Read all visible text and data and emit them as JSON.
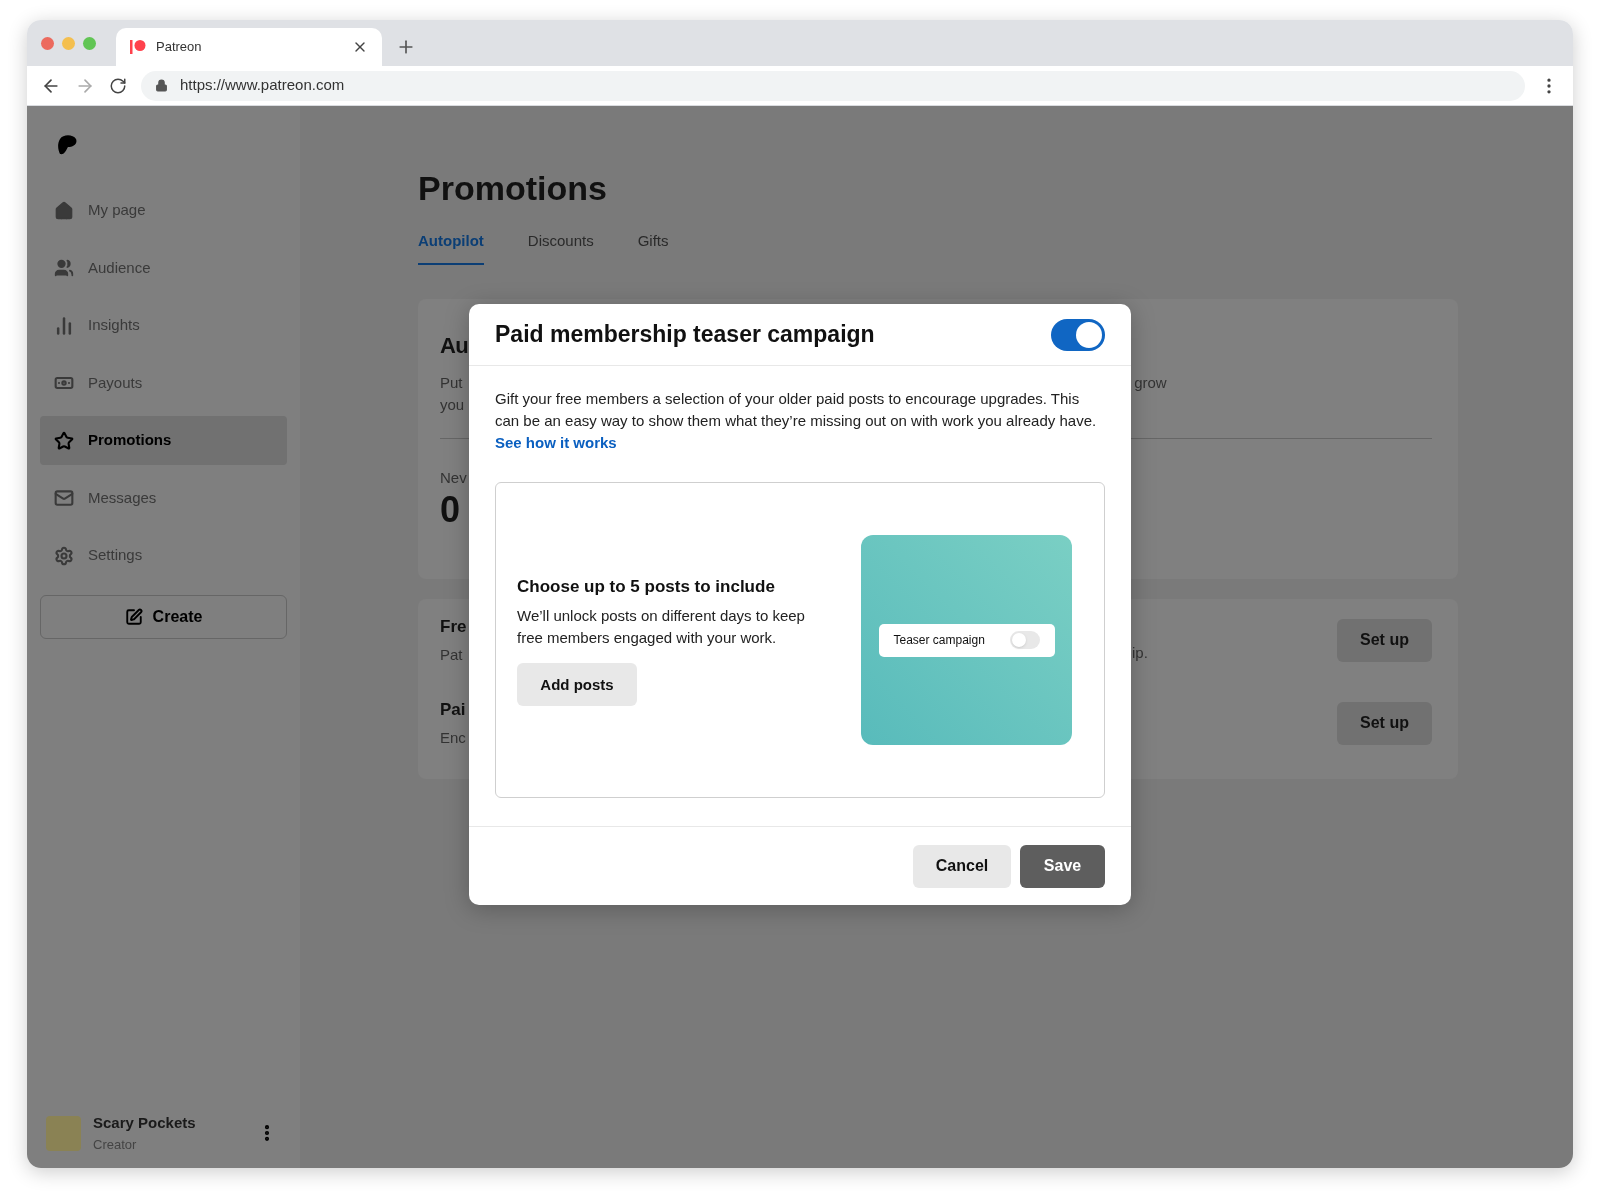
{
  "browser": {
    "tab_title": "Patreon",
    "url": "https://www.patreon.com"
  },
  "sidebar": {
    "items": [
      {
        "label": "My page",
        "selected": false
      },
      {
        "label": "Audience",
        "selected": false
      },
      {
        "label": "Insights",
        "selected": false
      },
      {
        "label": "Payouts",
        "selected": false
      },
      {
        "label": "Promotions",
        "selected": true
      },
      {
        "label": "Messages",
        "selected": false
      },
      {
        "label": "Settings",
        "selected": false
      }
    ],
    "create_button": "Create",
    "user": {
      "name": "Scary Pockets",
      "role": "Creator"
    }
  },
  "page": {
    "title": "Promotions",
    "tabs": [
      {
        "label": "Autopilot",
        "selected": true
      },
      {
        "label": "Discounts",
        "selected": false
      },
      {
        "label": "Gifts",
        "selected": false
      }
    ],
    "summary_card": {
      "heading": "Au",
      "text_lines": [
        "Put",
        "you"
      ],
      "text_right": "grow",
      "stat_label": "Nev",
      "stat_value": "0"
    },
    "rows": [
      {
        "title": "Fre",
        "text": "Pat",
        "text_right": "ip.",
        "button": "Set up"
      },
      {
        "title": "Pai",
        "text": "Enc",
        "button": "Set up"
      }
    ]
  },
  "modal": {
    "title": "Paid membership teaser campaign",
    "on": true,
    "description": "Gift your free members a selection of your older paid posts to encourage upgrades. This can be an easy way to show them what they’re missing out on with work you already have.",
    "link": "See how it works",
    "panel": {
      "heading": "Choose up to 5 posts to include",
      "text": "We’ll unlock posts on different days to keep free members engaged with your work.",
      "button": "Add posts",
      "preview_label": "Teaser campaign",
      "preview_on": false
    },
    "buttons": {
      "cancel": "Cancel",
      "save": "Save"
    }
  }
}
